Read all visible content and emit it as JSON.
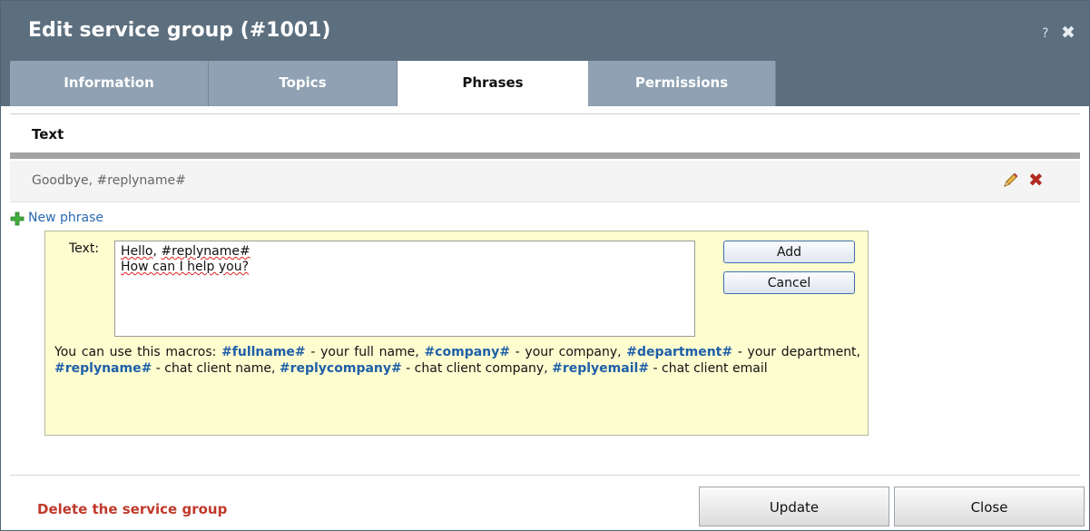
{
  "dialog": {
    "title": "Edit service group (#1001)",
    "help_label": "?",
    "close_label": "✖"
  },
  "tabs": [
    {
      "label": "Information",
      "active": false
    },
    {
      "label": "Topics",
      "active": false
    },
    {
      "label": "Phrases",
      "active": true
    },
    {
      "label": "Permissions",
      "active": false
    }
  ],
  "phrases_table": {
    "column_header": "Text",
    "rows": [
      {
        "text": "Goodbye, #replyname#",
        "edit_icon": "pencil-icon",
        "delete_icon": "delete-x-icon"
      }
    ]
  },
  "new_phrase": {
    "label": "New phrase",
    "icon": "plus-icon"
  },
  "form": {
    "text_label": "Text:",
    "text_value_line1_prefix": "Hello, ",
    "text_value_line1_word": "#replyname#",
    "text_value_line2": "How can I help you?",
    "add_label": "Add",
    "cancel_label": "Cancel",
    "macros_intro": "You can use this macros: ",
    "macros": [
      {
        "macro": "#fullname#",
        "desc": " - your full name, "
      },
      {
        "macro": "#company#",
        "desc": " - your company, "
      },
      {
        "macro": "#department#",
        "desc": " - your department, "
      },
      {
        "macro": "#replyname#",
        "desc": " - chat client name, "
      },
      {
        "macro": "#replycompany#",
        "desc": " - chat client company, "
      },
      {
        "macro": "#replyemail#",
        "desc": " - chat client email"
      }
    ]
  },
  "footer": {
    "delete_label": "Delete the service group",
    "update_label": "Update",
    "close_label": "Close"
  },
  "colors": {
    "titlebar": "#5c6f7f",
    "tab_inactive": "#8fa1b2",
    "form_bg": "#fdfdd0",
    "macro_link": "#1f5fa8",
    "delete_red": "#c0392b"
  }
}
